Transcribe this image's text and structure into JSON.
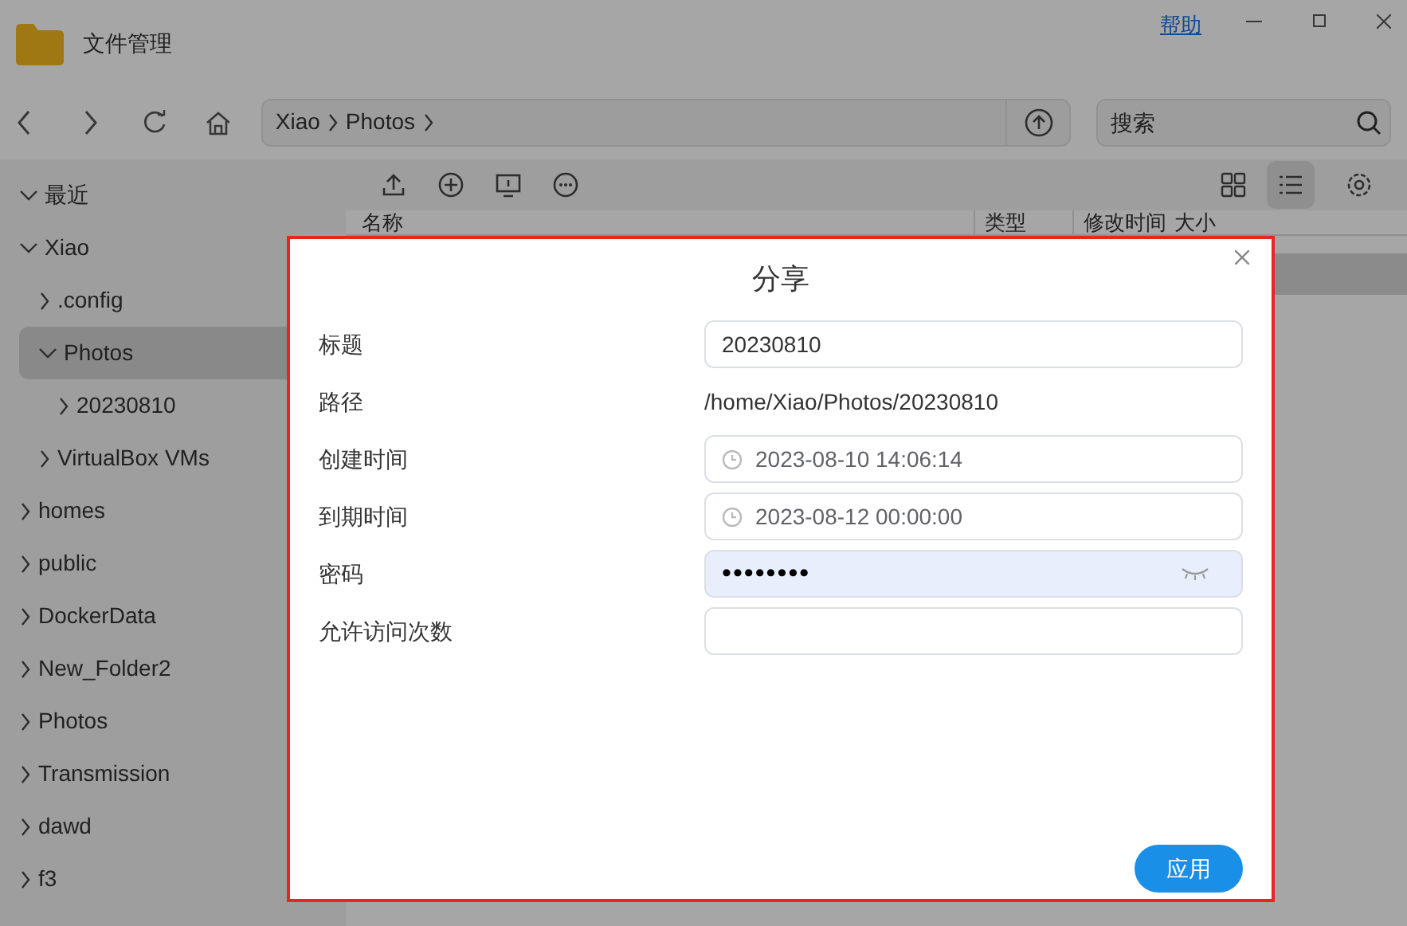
{
  "window": {
    "title": "文件管理",
    "help_link": "帮助"
  },
  "nav": {
    "breadcrumb": [
      "Xiao",
      "Photos"
    ],
    "search": {
      "placeholder": "搜索"
    }
  },
  "sidebar": {
    "items": [
      {
        "label": "最近",
        "expanded": true,
        "selected": false
      },
      {
        "label": "Xiao",
        "expanded": true,
        "selected": false,
        "children": [
          {
            "label": ".config",
            "expanded": false,
            "selected": false
          },
          {
            "label": "Photos",
            "expanded": true,
            "selected": true,
            "children": [
              {
                "label": "20230810",
                "expanded": false,
                "selected": false
              }
            ]
          },
          {
            "label": "VirtualBox VMs",
            "expanded": false,
            "selected": false
          }
        ]
      },
      {
        "label": "homes",
        "expanded": false,
        "selected": false
      },
      {
        "label": "public",
        "expanded": false,
        "selected": false
      },
      {
        "label": "DockerData",
        "expanded": false,
        "selected": false
      },
      {
        "label": "New_Folder2",
        "expanded": false,
        "selected": false
      },
      {
        "label": "Photos",
        "expanded": false,
        "selected": false
      },
      {
        "label": "Transmission",
        "expanded": false,
        "selected": false
      },
      {
        "label": "dawd",
        "expanded": false,
        "selected": false
      },
      {
        "label": "f3",
        "expanded": false,
        "selected": false
      }
    ]
  },
  "toolbar": {
    "views": [
      {
        "kind": "grid",
        "selected": false
      },
      {
        "kind": "list",
        "selected": true
      }
    ]
  },
  "table": {
    "columns": [
      "名称",
      "类型",
      "修改时间",
      "大小"
    ]
  },
  "dialog": {
    "title": "分享",
    "fields": [
      {
        "kind": "text",
        "label": "标题",
        "value": "20230810"
      },
      {
        "kind": "static",
        "label": "路径",
        "value": "/home/Xiao/Photos/20230810"
      },
      {
        "kind": "datetime",
        "label": "创建时间",
        "value": "2023-08-10 14:06:14"
      },
      {
        "kind": "datetime",
        "label": "到期时间",
        "value": "2023-08-12 00:00:00"
      },
      {
        "kind": "password",
        "label": "密码",
        "value": "••••••••"
      },
      {
        "kind": "text",
        "label": "允许访问次数"
      }
    ],
    "button": "应用"
  }
}
